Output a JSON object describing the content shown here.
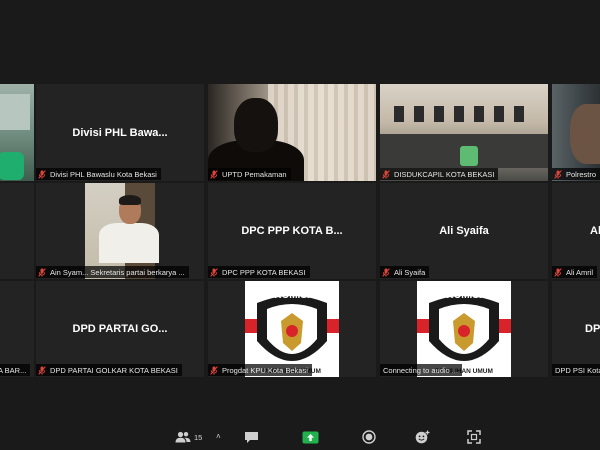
{
  "tiles": {
    "r1c2": {
      "center_name": "Divisi PHL Bawa...",
      "label": "Divisi PHL Bawaslu Kota Bekasi"
    },
    "r1c3": {
      "label": "UPTD Pemakaman"
    },
    "r1c4": {
      "label": "DISDUKCAPIL KOTA BEKASI"
    },
    "r1c5": {
      "label": "Polrestro"
    },
    "r2c2": {
      "label": "Ain Syam... Sekretaris partai berkarya ..."
    },
    "r2c3": {
      "center_name": "DPC PPP KOTA B...",
      "label": "DPC PPP KOTA BEKASI"
    },
    "r2c4": {
      "center_name": "Ali Syaifa",
      "label": "Ali Syaifa"
    },
    "r2c5": {
      "center_name": "Ali",
      "label": "Ali Amril"
    },
    "r3c1": {
      "label": "A BAR..."
    },
    "r3c2": {
      "center_name": "DPD PARTAI GO...",
      "label": "DPD PARTAI GOLKAR KOTA BEKASI"
    },
    "r3c3": {
      "label": "Progdat KPU Kota Bekasi"
    },
    "r3c4": {
      "label": "Connecting to audio ..."
    },
    "r3c5": {
      "center_name": "DP",
      "label": "DPD PSI Kota"
    }
  },
  "logo": {
    "top_text": "KOMISI",
    "side_text": "PEMILIHAN UMUM"
  },
  "toolbar": {
    "participants_count": "15"
  },
  "colors": {
    "active_border": "#c8e04a",
    "share_green": "#22b14c",
    "muted_mic": "#e0443a",
    "kpu_red": "#d9232a"
  }
}
